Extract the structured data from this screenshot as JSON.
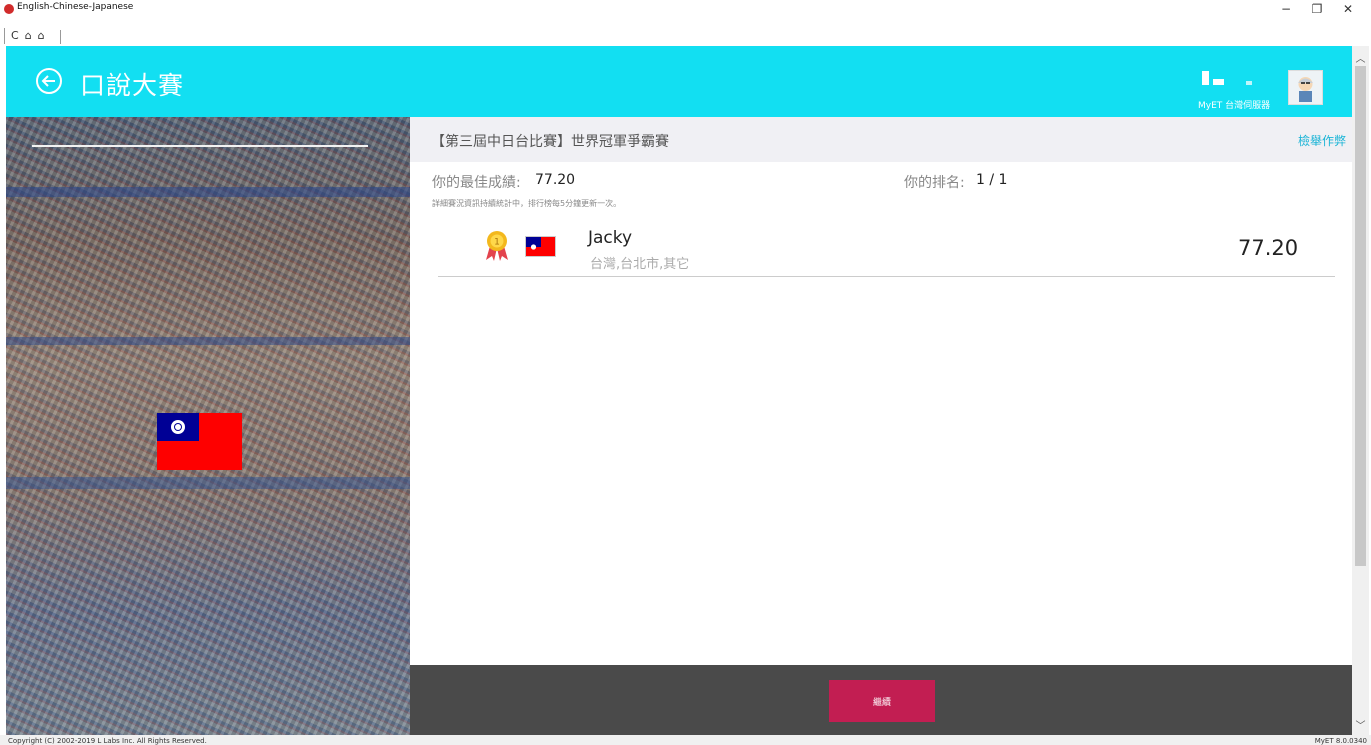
{
  "window": {
    "title": "English-Chinese-Japanese",
    "minimize": "−",
    "maximize": "❐",
    "close": "✕",
    "nav": {
      "refresh": "C",
      "home": "⌂",
      "home2": "⌂"
    }
  },
  "header": {
    "title": "口說大賽",
    "server_label": "MyET 台灣伺服器"
  },
  "contest": {
    "title": "【第三屆中日台比賽】世界冠軍爭霸賽",
    "report_link": "檢舉作弊",
    "best_score_label": "你的最佳成績:",
    "best_score_value": "77.20",
    "rank_label": "你的排名:",
    "rank_value": "1 / 1",
    "note": "詳細賽況資訊持續統計中，排行榜每5分鐘更新一次。"
  },
  "leaderboard": [
    {
      "rank": 1,
      "name": "Jacky",
      "location": "台灣,台北市,其它",
      "score": "77.20"
    }
  ],
  "actions": {
    "continue_label": "繼續"
  },
  "statusbar": {
    "copyright": "Copyright (C) 2002-2019 L Labs Inc. All Rights Reserved.",
    "version": "MyET 8.0.0340"
  },
  "colors": {
    "header": "#12dff2",
    "continue_button": "#c21e52",
    "bottom_bar": "#4a4a4a",
    "link": "#1ab4d6"
  }
}
